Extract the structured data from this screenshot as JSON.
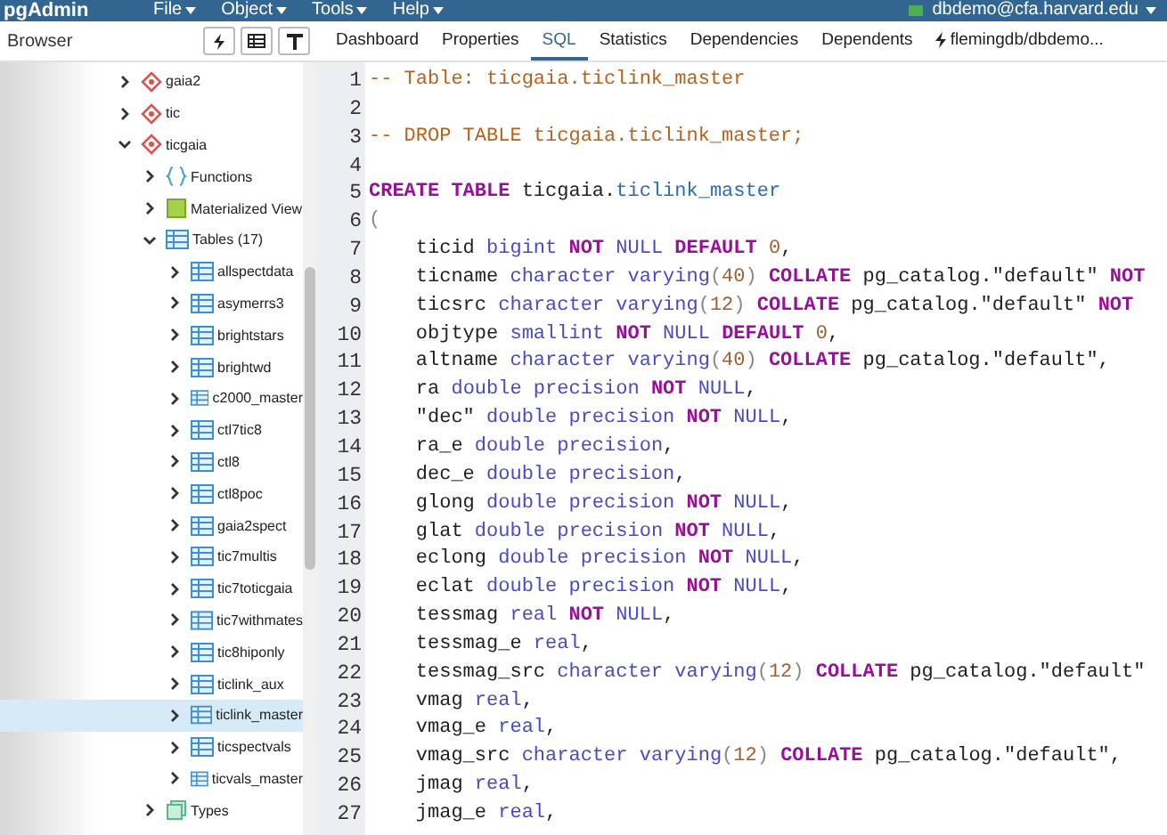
{
  "app_bar": {
    "logo": "pgAdmin",
    "menus": [
      "File",
      "Object",
      "Tools",
      "Help"
    ],
    "user": "dbdemo@cfa.harvard.edu"
  },
  "browser": {
    "title": "Browser",
    "tree": [
      {
        "label": "gaia2",
        "kind": "database",
        "expanded": false,
        "selected": false
      },
      {
        "label": "tic",
        "kind": "database",
        "expanded": false,
        "selected": false
      },
      {
        "label": "ticgaia",
        "kind": "database",
        "expanded": true,
        "selected": false,
        "children": [
          {
            "label": "Functions",
            "kind": "functions",
            "expanded": false,
            "selected": false
          },
          {
            "label": "Materialized View",
            "kind": "matview",
            "expanded": false,
            "selected": false
          },
          {
            "label": "Tables (17)",
            "kind": "tables",
            "expanded": true,
            "selected": false,
            "children": [
              {
                "label": "allspectdata",
                "kind": "table",
                "expanded": false,
                "selected": false
              },
              {
                "label": "asymerrs3",
                "kind": "table",
                "expanded": false,
                "selected": false
              },
              {
                "label": "brightstars",
                "kind": "table",
                "expanded": false,
                "selected": false
              },
              {
                "label": "brightwd",
                "kind": "table",
                "expanded": false,
                "selected": false
              },
              {
                "label": "c2000_master",
                "kind": "table",
                "expanded": false,
                "selected": false
              },
              {
                "label": "ctl7tic8",
                "kind": "table",
                "expanded": false,
                "selected": false
              },
              {
                "label": "ctl8",
                "kind": "table",
                "expanded": false,
                "selected": false
              },
              {
                "label": "ctl8poc",
                "kind": "table",
                "expanded": false,
                "selected": false
              },
              {
                "label": "gaia2spect",
                "kind": "table",
                "expanded": false,
                "selected": false
              },
              {
                "label": "tic7multis",
                "kind": "table",
                "expanded": false,
                "selected": false
              },
              {
                "label": "tic7toticgaia",
                "kind": "table",
                "expanded": false,
                "selected": false
              },
              {
                "label": "tic7withmates",
                "kind": "table",
                "expanded": false,
                "selected": false
              },
              {
                "label": "tic8hiponly",
                "kind": "table",
                "expanded": false,
                "selected": false
              },
              {
                "label": "ticlink_aux",
                "kind": "table",
                "expanded": false,
                "selected": false
              },
              {
                "label": "ticlink_master",
                "kind": "table",
                "expanded": false,
                "selected": true
              },
              {
                "label": "ticspectvals",
                "kind": "table",
                "expanded": false,
                "selected": false
              },
              {
                "label": "ticvals_master",
                "kind": "table",
                "expanded": false,
                "selected": false
              }
            ]
          },
          {
            "label": "Types",
            "kind": "types",
            "expanded": false,
            "selected": false
          }
        ]
      }
    ]
  },
  "tabs": [
    {
      "label": "Dashboard",
      "selected": false
    },
    {
      "label": "Properties",
      "selected": false
    },
    {
      "label": "SQL",
      "selected": true
    },
    {
      "label": "Statistics",
      "selected": false
    },
    {
      "label": "Dependencies",
      "selected": false
    },
    {
      "label": "Dependents",
      "selected": false
    },
    {
      "label": "flemingdb/dbdemo...",
      "selected": false,
      "kind": "query"
    }
  ],
  "editor": {
    "lines": [
      {
        "number": "1",
        "tokens": [
          {
            "kind": "comment",
            "text": "-- Table: ticgaia.ticlink_master"
          }
        ]
      },
      {
        "number": "2"
      },
      {
        "number": "3",
        "tokens": [
          {
            "kind": "comment",
            "text": "-- DROP TABLE ticgaia.ticlink_master;"
          }
        ]
      },
      {
        "number": "4"
      },
      {
        "number": "5",
        "tokens": [
          {
            "kind": "keyword",
            "text": "CREATE TABLE"
          },
          {
            "kind": "plain",
            "text": " ticgaia."
          },
          {
            "kind": "name",
            "text": "ticlink_master"
          }
        ]
      },
      {
        "number": "6",
        "tokens": [
          {
            "kind": "paren",
            "text": "("
          }
        ]
      },
      {
        "number": "7",
        "tokens": [
          {
            "kind": "plain",
            "text": "    ticid "
          },
          {
            "kind": "type",
            "text": "bigint "
          },
          {
            "kind": "keyword",
            "text": "NOT"
          },
          {
            "kind": "type",
            "text": " NULL "
          },
          {
            "kind": "keyword",
            "text": "DEFAULT "
          },
          {
            "kind": "number",
            "text": "0"
          },
          {
            "kind": "plain",
            "text": ","
          }
        ]
      },
      {
        "number": "8",
        "tokens": [
          {
            "kind": "plain",
            "text": "    ticname "
          },
          {
            "kind": "type",
            "text": "character varying"
          },
          {
            "kind": "paren",
            "text": "("
          },
          {
            "kind": "number",
            "text": "40"
          },
          {
            "kind": "paren",
            "text": ") "
          },
          {
            "kind": "keyword",
            "text": "COLLATE"
          },
          {
            "kind": "plain",
            "text": " pg_catalog.\"default\" "
          },
          {
            "kind": "keyword",
            "text": "NOT"
          }
        ]
      },
      {
        "number": "9",
        "tokens": [
          {
            "kind": "plain",
            "text": "    ticsrc "
          },
          {
            "kind": "type",
            "text": "character varying"
          },
          {
            "kind": "paren",
            "text": "("
          },
          {
            "kind": "number",
            "text": "12"
          },
          {
            "kind": "paren",
            "text": ") "
          },
          {
            "kind": "keyword",
            "text": "COLLATE"
          },
          {
            "kind": "plain",
            "text": " pg_catalog.\"default\" "
          },
          {
            "kind": "keyword",
            "text": "NOT"
          }
        ]
      },
      {
        "number": "10",
        "tokens": [
          {
            "kind": "plain",
            "text": "    objtype "
          },
          {
            "kind": "type",
            "text": "smallint "
          },
          {
            "kind": "keyword",
            "text": "NOT"
          },
          {
            "kind": "type",
            "text": " NULL "
          },
          {
            "kind": "keyword",
            "text": "DEFAULT "
          },
          {
            "kind": "number",
            "text": "0"
          },
          {
            "kind": "plain",
            "text": ","
          }
        ]
      },
      {
        "number": "11",
        "tokens": [
          {
            "kind": "plain",
            "text": "    altname "
          },
          {
            "kind": "type",
            "text": "character varying"
          },
          {
            "kind": "paren",
            "text": "("
          },
          {
            "kind": "number",
            "text": "40"
          },
          {
            "kind": "paren",
            "text": ") "
          },
          {
            "kind": "keyword",
            "text": "COLLATE"
          },
          {
            "kind": "plain",
            "text": " pg_catalog.\"default\","
          }
        ]
      },
      {
        "number": "12",
        "tokens": [
          {
            "kind": "plain",
            "text": "    ra "
          },
          {
            "kind": "type",
            "text": "double precision "
          },
          {
            "kind": "keyword",
            "text": "NOT"
          },
          {
            "kind": "type",
            "text": " NULL"
          },
          {
            "kind": "plain",
            "text": ","
          }
        ]
      },
      {
        "number": "13",
        "tokens": [
          {
            "kind": "plain",
            "text": "    \"dec\" "
          },
          {
            "kind": "type",
            "text": "double precision "
          },
          {
            "kind": "keyword",
            "text": "NOT"
          },
          {
            "kind": "type",
            "text": " NULL"
          },
          {
            "kind": "plain",
            "text": ","
          }
        ]
      },
      {
        "number": "14",
        "tokens": [
          {
            "kind": "plain",
            "text": "    ra_e "
          },
          {
            "kind": "type",
            "text": "double precision"
          },
          {
            "kind": "plain",
            "text": ","
          }
        ]
      },
      {
        "number": "15",
        "tokens": [
          {
            "kind": "plain",
            "text": "    dec_e "
          },
          {
            "kind": "type",
            "text": "double precision"
          },
          {
            "kind": "plain",
            "text": ","
          }
        ]
      },
      {
        "number": "16",
        "tokens": [
          {
            "kind": "plain",
            "text": "    glong "
          },
          {
            "kind": "type",
            "text": "double precision "
          },
          {
            "kind": "keyword",
            "text": "NOT"
          },
          {
            "kind": "type",
            "text": " NULL"
          },
          {
            "kind": "plain",
            "text": ","
          }
        ]
      },
      {
        "number": "17",
        "tokens": [
          {
            "kind": "plain",
            "text": "    glat "
          },
          {
            "kind": "type",
            "text": "double precision "
          },
          {
            "kind": "keyword",
            "text": "NOT"
          },
          {
            "kind": "type",
            "text": " NULL"
          },
          {
            "kind": "plain",
            "text": ","
          }
        ]
      },
      {
        "number": "18",
        "tokens": [
          {
            "kind": "plain",
            "text": "    eclong "
          },
          {
            "kind": "type",
            "text": "double precision "
          },
          {
            "kind": "keyword",
            "text": "NOT"
          },
          {
            "kind": "type",
            "text": " NULL"
          },
          {
            "kind": "plain",
            "text": ","
          }
        ]
      },
      {
        "number": "19",
        "tokens": [
          {
            "kind": "plain",
            "text": "    eclat "
          },
          {
            "kind": "type",
            "text": "double precision "
          },
          {
            "kind": "keyword",
            "text": "NOT"
          },
          {
            "kind": "type",
            "text": " NULL"
          },
          {
            "kind": "plain",
            "text": ","
          }
        ]
      },
      {
        "number": "20",
        "tokens": [
          {
            "kind": "plain",
            "text": "    tessmag "
          },
          {
            "kind": "type",
            "text": "real "
          },
          {
            "kind": "keyword",
            "text": "NOT"
          },
          {
            "kind": "type",
            "text": " NULL"
          },
          {
            "kind": "plain",
            "text": ","
          }
        ]
      },
      {
        "number": "21",
        "tokens": [
          {
            "kind": "plain",
            "text": "    tessmag_e "
          },
          {
            "kind": "type",
            "text": "real"
          },
          {
            "kind": "plain",
            "text": ","
          }
        ]
      },
      {
        "number": "22",
        "tokens": [
          {
            "kind": "plain",
            "text": "    tessmag_src "
          },
          {
            "kind": "type",
            "text": "character varying"
          },
          {
            "kind": "paren",
            "text": "("
          },
          {
            "kind": "number",
            "text": "12"
          },
          {
            "kind": "paren",
            "text": ") "
          },
          {
            "kind": "keyword",
            "text": "COLLATE"
          },
          {
            "kind": "plain",
            "text": " pg_catalog.\"default\""
          }
        ]
      },
      {
        "number": "23",
        "tokens": [
          {
            "kind": "plain",
            "text": "    vmag "
          },
          {
            "kind": "type",
            "text": "real"
          },
          {
            "kind": "plain",
            "text": ","
          }
        ]
      },
      {
        "number": "24",
        "tokens": [
          {
            "kind": "plain",
            "text": "    vmag_e "
          },
          {
            "kind": "type",
            "text": "real"
          },
          {
            "kind": "plain",
            "text": ","
          }
        ]
      },
      {
        "number": "25",
        "tokens": [
          {
            "kind": "plain",
            "text": "    vmag_src "
          },
          {
            "kind": "type",
            "text": "character varying"
          },
          {
            "kind": "paren",
            "text": "("
          },
          {
            "kind": "number",
            "text": "12"
          },
          {
            "kind": "paren",
            "text": ") "
          },
          {
            "kind": "keyword",
            "text": "COLLATE"
          },
          {
            "kind": "plain",
            "text": " pg_catalog.\"default\","
          }
        ]
      },
      {
        "number": "26",
        "tokens": [
          {
            "kind": "plain",
            "text": "    jmag "
          },
          {
            "kind": "type",
            "text": "real"
          },
          {
            "kind": "plain",
            "text": ","
          }
        ]
      },
      {
        "number": "27",
        "tokens": [
          {
            "kind": "plain",
            "text": "    jmag_e "
          },
          {
            "kind": "type",
            "text": "real"
          },
          {
            "kind": "plain",
            "text": ","
          }
        ]
      }
    ]
  }
}
